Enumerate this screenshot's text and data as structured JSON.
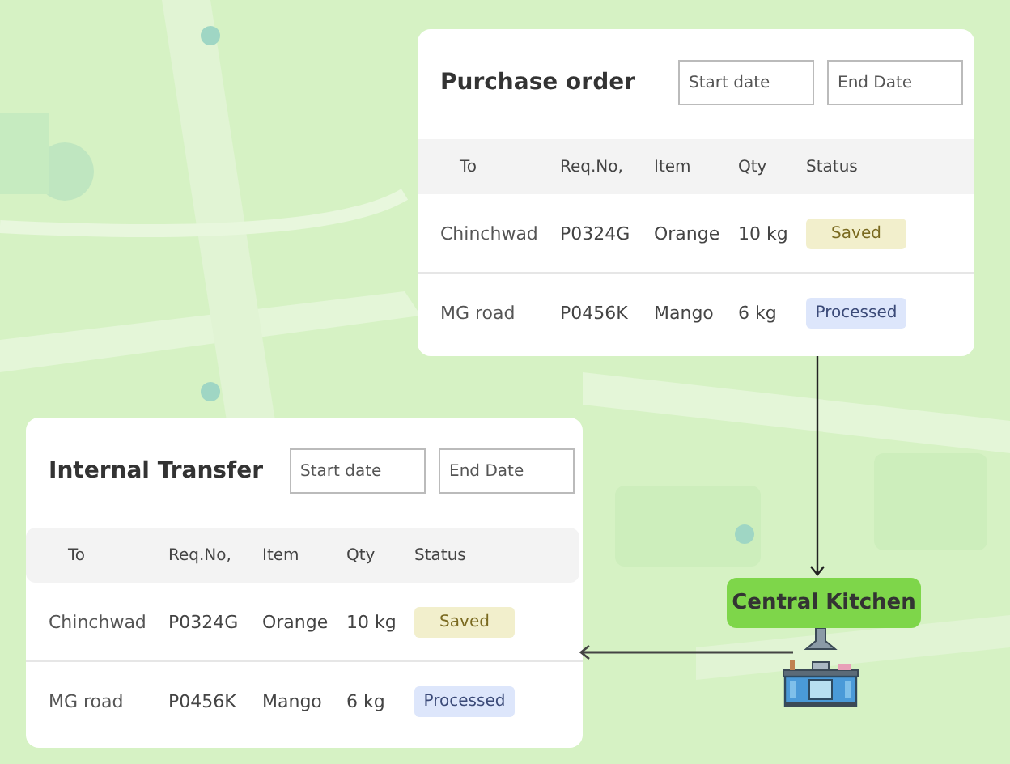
{
  "cards": [
    {
      "title": "Purchase order",
      "start_placeholder": "Start date",
      "end_placeholder": "End Date",
      "columns": [
        "To",
        "Req.No,",
        "Item",
        "Qty",
        "Status"
      ],
      "rows": [
        {
          "to": "Chinchwad",
          "req": "P0324G",
          "item": "Orange",
          "qty": "10 kg",
          "status": "Saved",
          "kind": "saved"
        },
        {
          "to": "MG road",
          "req": "P0456K",
          "item": "Mango",
          "qty": "6 kg",
          "status": "Processed",
          "kind": "processed"
        }
      ]
    },
    {
      "title": "Internal Transfer",
      "start_placeholder": "Start date",
      "end_placeholder": "End Date",
      "columns": [
        "To",
        "Req.No,",
        "Item",
        "Qty",
        "Status"
      ],
      "rows": [
        {
          "to": "Chinchwad",
          "req": "P0324G",
          "item": "Orange",
          "qty": "10 kg",
          "status": "Saved",
          "kind": "saved"
        },
        {
          "to": "MG road",
          "req": "P0456K",
          "item": "Mango",
          "qty": "6 kg",
          "status": "Processed",
          "kind": "processed"
        }
      ]
    }
  ],
  "hub": {
    "label": "Central Kitchen"
  }
}
